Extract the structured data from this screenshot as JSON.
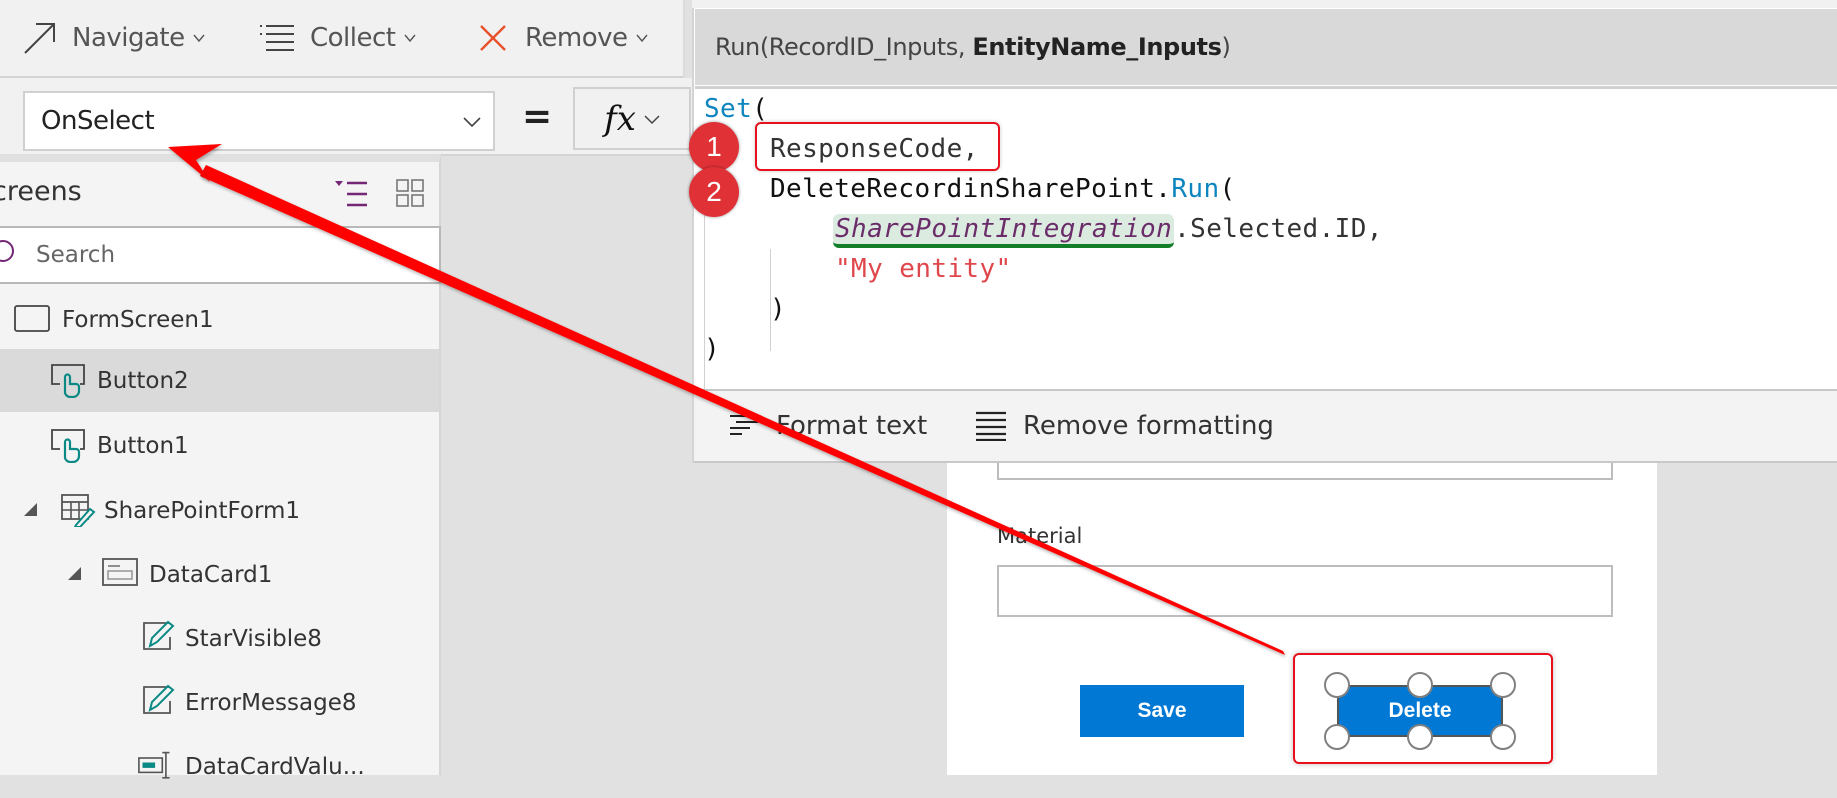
{
  "toolbar": {
    "items": [
      {
        "label": "Navigate",
        "icon": "navigate-arrow-icon"
      },
      {
        "label": "Collect",
        "icon": "collect-list-icon"
      },
      {
        "label": "Remove",
        "icon": "remove-x-icon"
      }
    ]
  },
  "property_bar": {
    "selected_property": "OnSelect",
    "equals": "=",
    "fx_label": "fx"
  },
  "formula_panel": {
    "signature_prefix": "Run(RecordID_Inputs, ",
    "signature_bold": "EntityName_Inputs",
    "signature_suffix": ")",
    "code": {
      "line1_kw": "Set",
      "line1_rest": "(",
      "line2": "ResponseCode,",
      "line3_obj": "DeleteRecordinSharePoint.",
      "line3_kw": "Run",
      "line3_rest": "(",
      "line4_ctl": "SharePointIntegration",
      "line4_rest": ".Selected.ID,",
      "line5_str": "\"My entity\"",
      "line6": ")",
      "line7": ")"
    },
    "bottom_actions": [
      {
        "label": "Format text",
        "icon": "format-text-icon"
      },
      {
        "label": "Remove formatting",
        "icon": "remove-formatting-icon"
      }
    ]
  },
  "tree_panel": {
    "title": "creens",
    "search_placeholder": "Search",
    "items": [
      {
        "label": "FormScreen1",
        "type": "screen",
        "selected": false
      },
      {
        "label": "Button2",
        "type": "button",
        "selected": true
      },
      {
        "label": "Button1",
        "type": "button",
        "selected": false
      },
      {
        "label": "SharePointForm1",
        "type": "form",
        "selected": false,
        "expanded": true
      },
      {
        "label": "DataCard1",
        "type": "datacard",
        "selected": false,
        "expanded": true
      },
      {
        "label": "StarVisible8",
        "type": "label",
        "selected": false
      },
      {
        "label": "ErrorMessage8",
        "type": "label",
        "selected": false
      },
      {
        "label": "DataCardValu...",
        "type": "textinput",
        "selected": false
      }
    ]
  },
  "canvas": {
    "material_label": "Material",
    "save_label": "Save",
    "delete_label": "Delete"
  },
  "annotations": {
    "badge1": "1",
    "badge2": "2",
    "arrow_color": "#ff0000"
  },
  "colors": {
    "accent_purple": "#742774",
    "button_blue": "#0078d4",
    "keyword_blue": "#0e85bf",
    "string_red": "#e0474c",
    "badge_red": "#e03137",
    "teal_icon": "#0b8a85"
  }
}
